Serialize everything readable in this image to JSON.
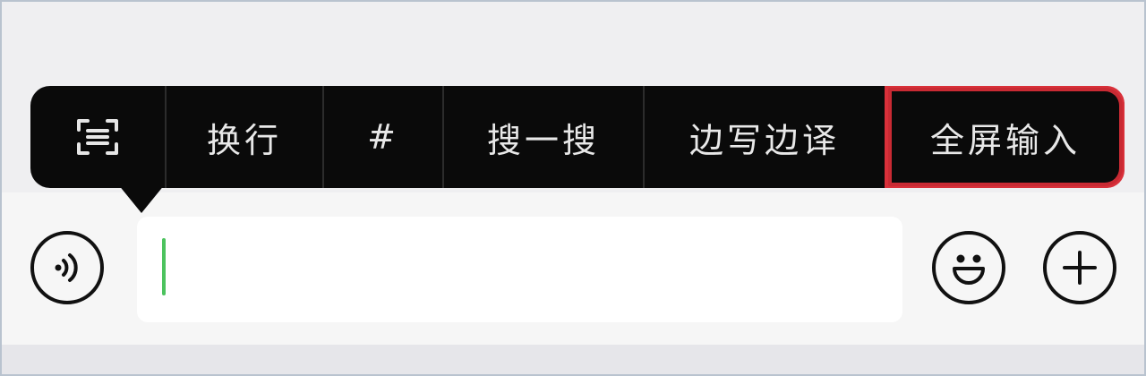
{
  "context_menu": {
    "items": [
      {
        "id": "scan",
        "icon": "scan-text-icon",
        "label": ""
      },
      {
        "id": "line-break",
        "label": "换行"
      },
      {
        "id": "hashtag",
        "label": "#"
      },
      {
        "id": "search",
        "label": "搜一搜"
      },
      {
        "id": "translate",
        "label": "边写边译"
      },
      {
        "id": "fullscreen",
        "label": "全屏输入",
        "highlighted": true
      }
    ],
    "highlight_color": "#d9303a"
  },
  "input_bar": {
    "voice_icon": "voice-input-icon",
    "text_value": "",
    "emoji_icon": "emoji-icon",
    "plus_icon": "plus-icon",
    "caret_color": "#4cc35e"
  }
}
